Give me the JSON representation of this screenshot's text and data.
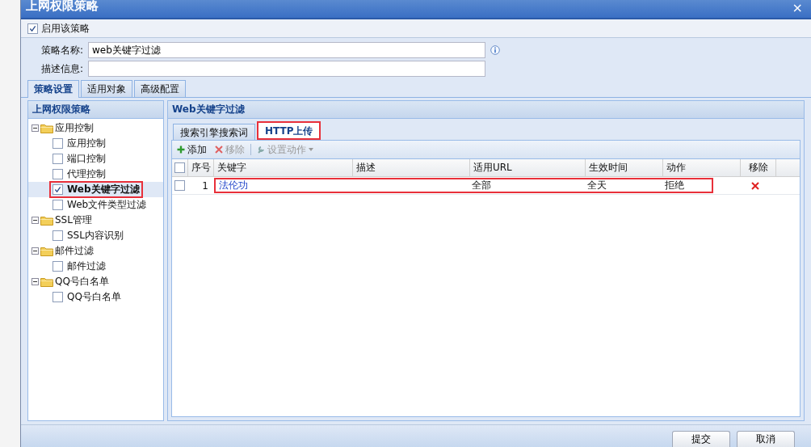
{
  "window": {
    "title": "上网权限策略",
    "close": "×"
  },
  "enable": {
    "label": "启用该策略",
    "checked": true
  },
  "form": [
    {
      "label": "策略名称:",
      "value": "web关键字过滤",
      "info": true
    },
    {
      "label": "描述信息:",
      "info": false
    }
  ],
  "tabs": [
    {
      "label": "策略设置",
      "selected": true
    },
    {
      "label": "适用对象",
      "selected": false
    },
    {
      "label": "高级配置",
      "selected": false
    }
  ],
  "tree": {
    "title": "上网权限策略",
    "items": [
      {
        "label": "应用控制",
        "expanded": true,
        "children": [
          {
            "label": "应用控制",
            "checked": false,
            "selected": false,
            "highlighted": false
          },
          {
            "label": "端口控制",
            "checked": false,
            "selected": false,
            "highlighted": false
          },
          {
            "label": "代理控制",
            "checked": false,
            "selected": false,
            "highlighted": false
          },
          {
            "label": "Web关键字过滤",
            "checked": true,
            "selected": true,
            "highlighted": true
          },
          {
            "label": "Web文件类型过滤",
            "checked": false,
            "selected": false,
            "highlighted": false
          }
        ]
      },
      {
        "label": "SSL管理",
        "expanded": true,
        "children": [
          {
            "label": "SSL内容识别",
            "checked": false,
            "selected": false,
            "highlighted": false
          }
        ]
      },
      {
        "label": "邮件过滤",
        "expanded": true,
        "children": [
          {
            "label": "邮件过滤",
            "checked": false,
            "selected": false,
            "highlighted": false
          }
        ]
      },
      {
        "label": "QQ号白名单",
        "expanded": true,
        "children": [
          {
            "label": "QQ号白名单",
            "checked": false,
            "selected": false,
            "highlighted": false
          }
        ]
      }
    ]
  },
  "panel": {
    "title": "Web关键字过滤",
    "tabs": [
      {
        "label": "搜索引擎搜索词",
        "selected": false,
        "highlighted": false
      },
      {
        "label": "HTTP上传",
        "selected": true,
        "highlighted": true
      }
    ],
    "toolbar": [
      {
        "kind": "add",
        "label": "添加",
        "disabled": false
      },
      {
        "kind": "remove",
        "label": "移除",
        "disabled": true
      },
      {
        "kind": "settings",
        "label": "设置动作",
        "disabled": true
      }
    ],
    "table": {
      "header_checked": false,
      "columns": [
        "序号",
        "关键字",
        "描述",
        "适用URL",
        "生效时间",
        "动作",
        "移除"
      ],
      "rows": [
        {
          "number": "1",
          "keyword": "法伦功",
          "url": "全部",
          "time": "全天",
          "action": "拒绝",
          "checked": false,
          "highlighted": true
        }
      ]
    }
  },
  "buttons": [
    "提交",
    "取消"
  ]
}
